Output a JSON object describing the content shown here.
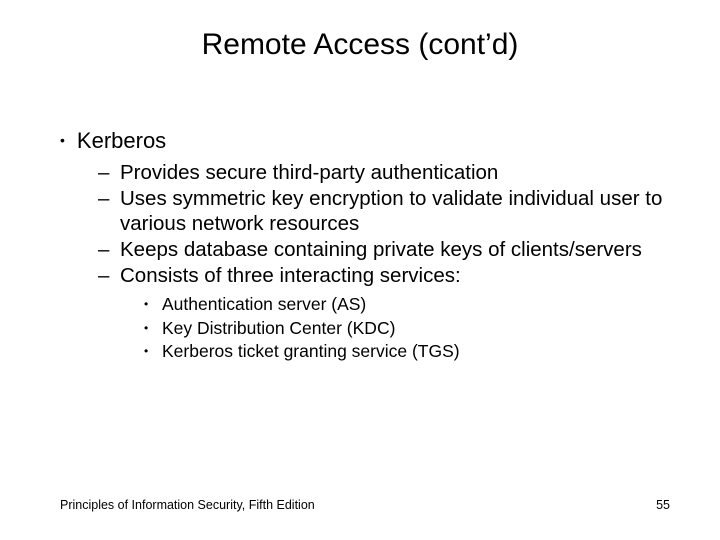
{
  "title": "Remote Access (cont’d)",
  "level1": [
    {
      "text": "Kerberos",
      "level2": [
        {
          "text": "Provides secure third-party authentication"
        },
        {
          "text": "Uses symmetric key encryption to validate individual user to various network resources"
        },
        {
          "text": "Keeps database containing private keys of clients/servers"
        },
        {
          "text": "Consists of three interacting services:",
          "level3": [
            {
              "text": "Authentication server (AS)"
            },
            {
              "text": "Key Distribution Center (KDC)"
            },
            {
              "text": "Kerberos ticket granting service (TGS)"
            }
          ]
        }
      ]
    }
  ],
  "footer": {
    "source": "Principles of Information Security, Fifth Edition",
    "page": "55"
  }
}
